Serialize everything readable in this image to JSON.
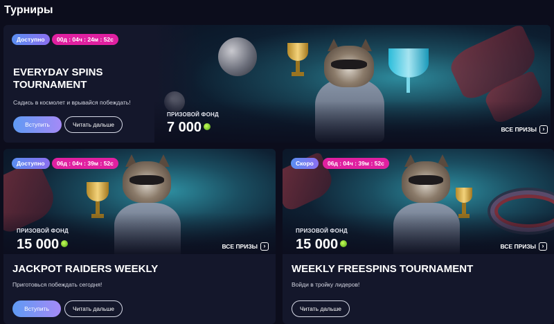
{
  "page": {
    "title": "Турниры"
  },
  "cards": [
    {
      "status": "Доступно",
      "timer": "00д : 04ч : 24м : 52с",
      "title": "EVERYDAY SPINS TOURNAMENT",
      "description": "Садись в космолет и врывайся побеждать!",
      "prize_label": "ПРИЗОВОЙ ФОНД",
      "prize_amount": "7 000",
      "all_prizes": "ВСЕ ПРИЗЫ",
      "join_label": "Вступить",
      "more_label": "Читать дальше"
    },
    {
      "status": "Доступно",
      "timer": "06д : 04ч : 39м : 52с",
      "title": "JACKPOT RAIDERS WEEKLY",
      "description": "Приготовься побеждать сегодня!",
      "prize_label": "ПРИЗОВОЙ ФОНД",
      "prize_amount": "15 000",
      "all_prizes": "ВСЕ ПРИЗЫ",
      "join_label": "Вступить",
      "more_label": "Читать дальше"
    },
    {
      "status": "Скоро",
      "timer": "06д : 04ч : 39м : 52с",
      "title": "WEEKLY FREESPINS TOURNAMENT",
      "description": "Войди в тройку лидеров!",
      "prize_label": "ПРИЗОВОЙ ФОНД",
      "prize_amount": "15 000",
      "all_prizes": "ВСЕ ПРИЗЫ",
      "more_label": "Читать дальше"
    }
  ],
  "colors": {
    "background": "#0c0d1c",
    "card": "#14172b",
    "status_badge": "#7a8cf0",
    "timer_badge": "#e020a0",
    "coin": "#7ed321"
  },
  "icons": {
    "coin": "coin-icon",
    "chevron": "chevron-right-icon"
  }
}
